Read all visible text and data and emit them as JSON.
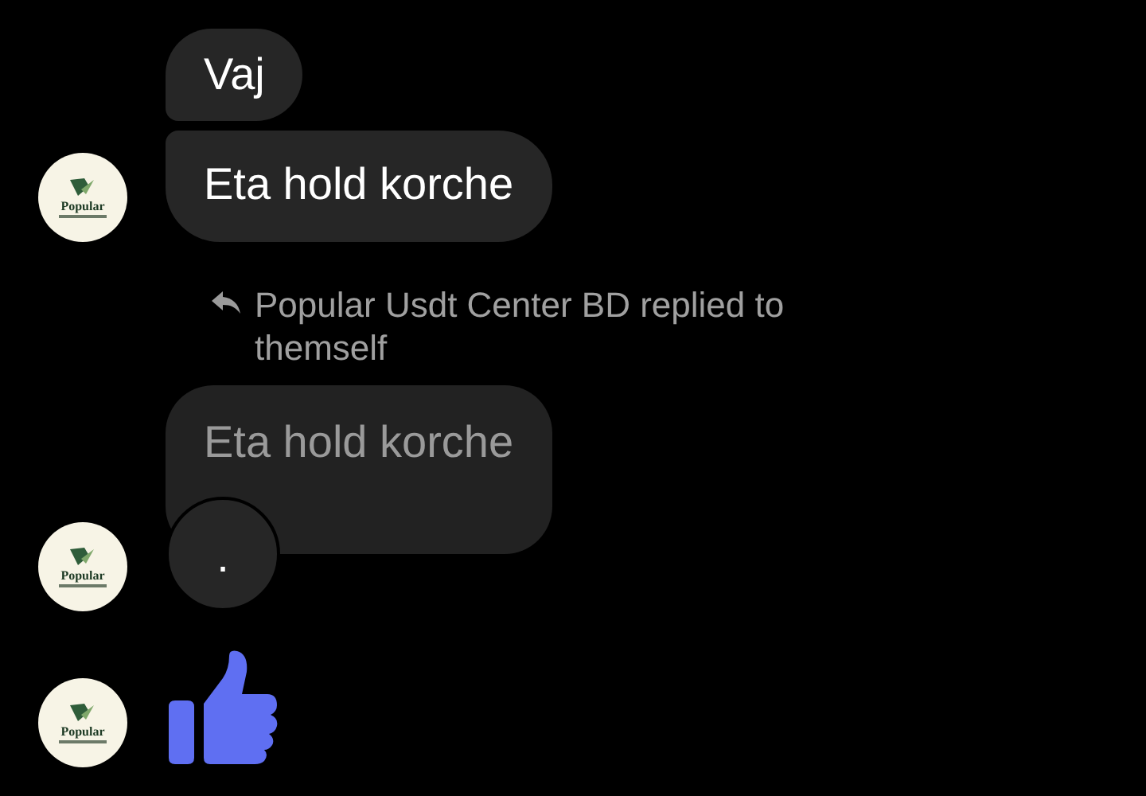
{
  "messages": [
    {
      "kind": "text",
      "text": "Vaj",
      "avatar": false
    },
    {
      "kind": "text",
      "text": "Eta hold korche",
      "avatar": true,
      "avatar_label": "Popular"
    },
    {
      "kind": "reply_note",
      "text": "Popular Usdt Center BD replied to themself"
    },
    {
      "kind": "reply",
      "quoted": "Eta hold korche",
      "text": ".",
      "avatar": true,
      "avatar_label": "Popular"
    },
    {
      "kind": "like",
      "avatar": true,
      "avatar_label": "Popular"
    }
  ]
}
